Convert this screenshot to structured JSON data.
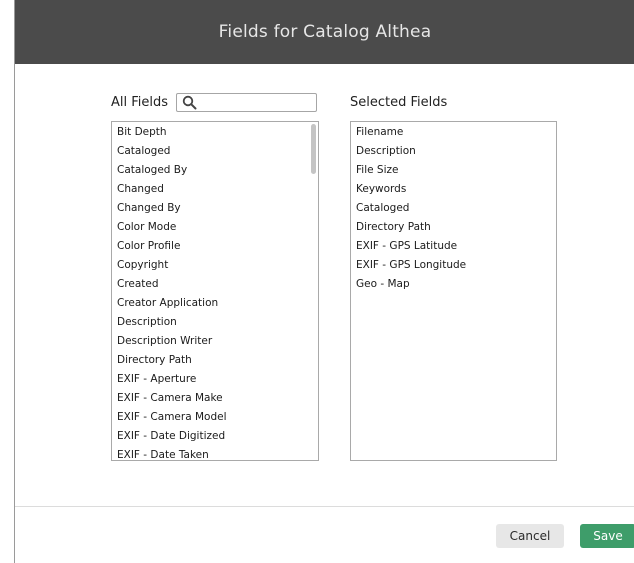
{
  "dialog": {
    "title": "Fields for Catalog Althea"
  },
  "all_fields": {
    "label": "All Fields",
    "search_value": "",
    "search_icon": "magnifier-icon",
    "items": [
      "Bit Depth",
      "Cataloged",
      "Cataloged By",
      "Changed",
      "Changed By",
      "Color Mode",
      "Color Profile",
      "Copyright",
      "Created",
      "Creator Application",
      "Description",
      "Description Writer",
      "Directory Path",
      "EXIF - Aperture",
      "EXIF - Camera Make",
      "EXIF - Camera Model",
      "EXIF - Date Digitized",
      "EXIF - Date Taken"
    ]
  },
  "selected_fields": {
    "label": "Selected Fields",
    "items": [
      "Filename",
      "Description",
      "File Size",
      "Keywords",
      "Cataloged",
      "Directory Path",
      "EXIF - GPS Latitude",
      "EXIF - GPS Longitude",
      "Geo - Map"
    ]
  },
  "footer": {
    "cancel_label": "Cancel",
    "save_label": "Save"
  },
  "colors": {
    "header_bg": "#4b4b4b",
    "save_bg": "#3e9d6a",
    "cancel_bg": "#e7e7e7"
  }
}
